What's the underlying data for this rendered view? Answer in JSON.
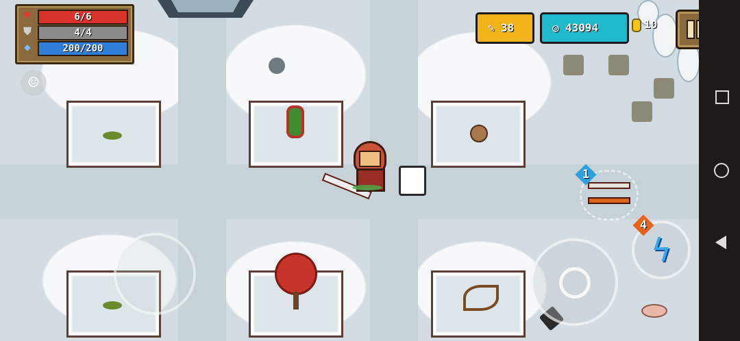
{
  "hud": {
    "hp": "6/6",
    "armor": "4/4",
    "energy": "200/200",
    "materials": "38",
    "gems": "43094",
    "coins": "10"
  },
  "icons": {
    "hp": "heart-icon",
    "armor": "shield-icon",
    "energy": "diamond-icon",
    "emote": "smiley-icon",
    "materials": "feather-icon",
    "gems": "gem-icon",
    "coins": "coin-icon",
    "pause": "pause-icon",
    "skill": "lightning-icon",
    "attack": "crosshair-icon"
  },
  "weapon_switch": {
    "slot": "1"
  },
  "skill": {
    "charges": "4"
  },
  "colors": {
    "hp": "#d8322b",
    "armor": "#8a8a8a",
    "energy": "#2f7ed8",
    "materials": "#f2b21a",
    "gems": "#20b9cc"
  }
}
